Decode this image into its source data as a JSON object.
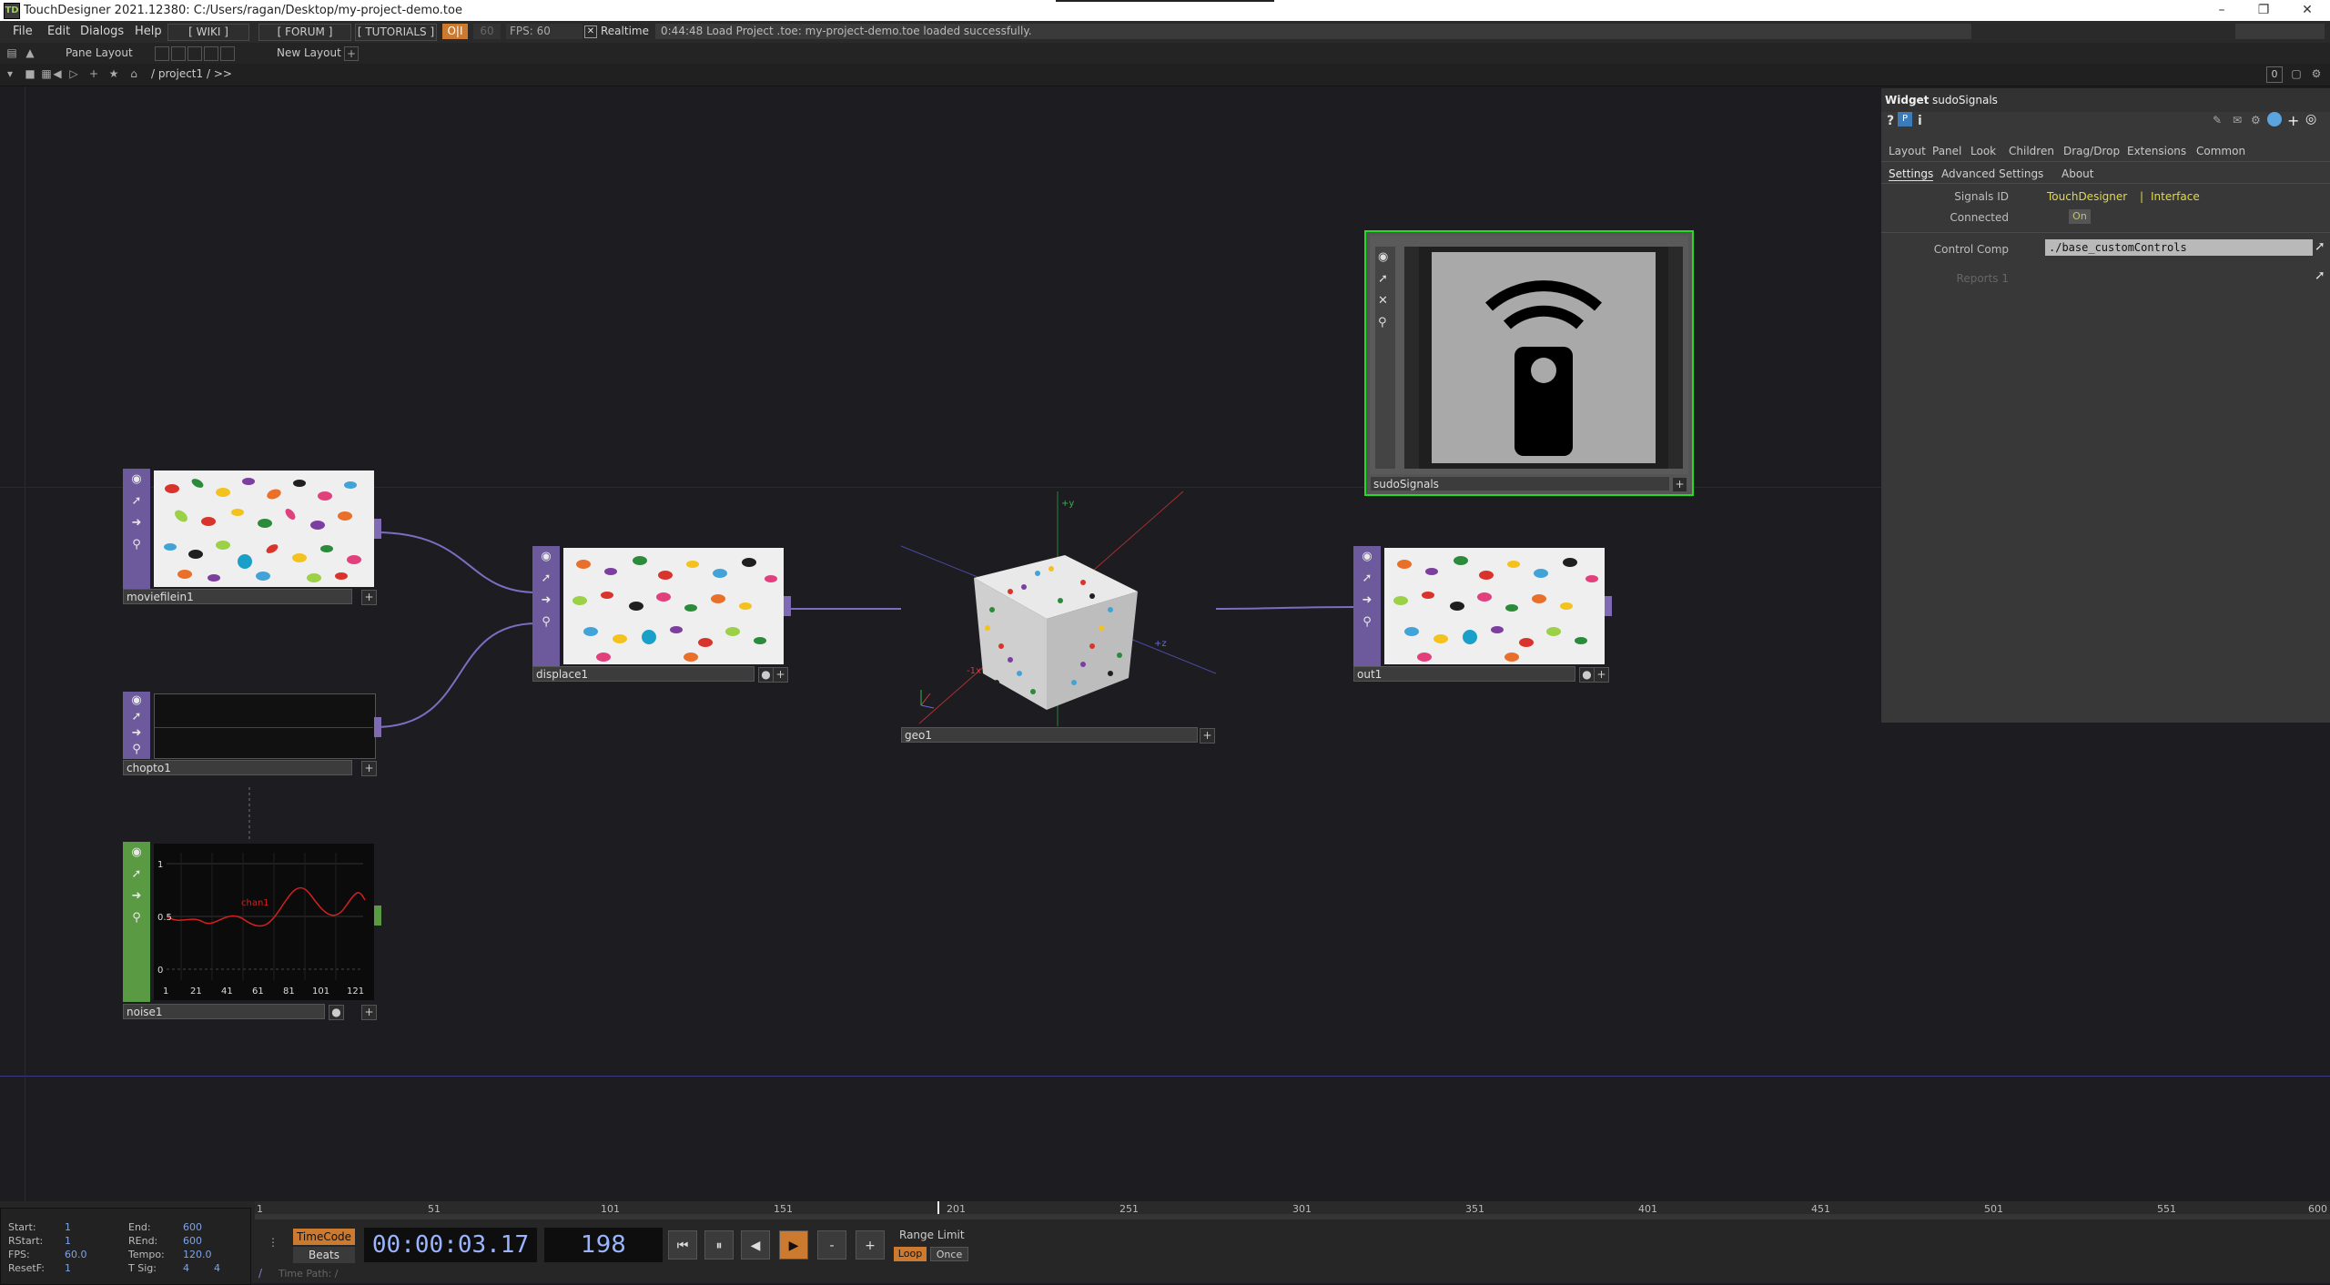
{
  "window": {
    "title": "TouchDesigner 2021.12380: C:/Users/ragan/Desktop/my-project-demo.toe"
  },
  "menu": {
    "items": [
      "File",
      "Edit",
      "Dialogs",
      "Help"
    ],
    "wiki": "[ WIKI ]",
    "forum": "[ FORUM ]",
    "tutorials": "[ TUTORIALS ]",
    "oi": "O|I",
    "fps_cook": "60",
    "fps_label": "FPS: 60",
    "realtime": "Realtime",
    "message": "0:44:48 Load Project .toe: my-project-demo.toe loaded successfully."
  },
  "toolbar": {
    "pane_layout": "Pane Layout",
    "new_layout": "New Layout",
    "plus": "+",
    "path": "/ project1 / >>",
    "counter": "0"
  },
  "nodes": {
    "moviefilein": "moviefilein1",
    "chopto": "chopto1",
    "noise": "noise1",
    "displace": "displace1",
    "geo": "geo1",
    "out": "out1",
    "sudo": "sudoSignals"
  },
  "noise_chart": {
    "channel": "chan1",
    "y_ticks": [
      "1",
      "0.5",
      "0"
    ],
    "x_ticks": [
      "1",
      "21",
      "41",
      "61",
      "81",
      "101",
      "121"
    ]
  },
  "geo_axes": {
    "y": "+y",
    "x": "-1x",
    "z": "+z"
  },
  "params": {
    "type": "Widget",
    "name": "sudoSignals",
    "tabs": [
      "Layout",
      "Panel",
      "Look",
      "Children",
      "Drag/Drop",
      "Extensions",
      "Common"
    ],
    "subtabs": [
      "Settings",
      "Advanced Settings",
      "About"
    ],
    "signals_id_label": "Signals ID",
    "signals_id_value1": "TouchDesigner",
    "signals_id_sep": "|",
    "signals_id_value2": "Interface",
    "connected_label": "Connected",
    "connected_value": "On",
    "control_comp_label": "Control Comp",
    "control_comp_value": "./base_customControls",
    "reports_label": "Reports 1"
  },
  "timeline": {
    "ticks": [
      "1",
      "51",
      "101",
      "151",
      "201",
      "251",
      "301",
      "351",
      "401",
      "451",
      "501",
      "551",
      "600"
    ],
    "start_l": "Start:",
    "start_v": "1",
    "end_l": "End:",
    "end_v": "600",
    "rstart_l": "RStart:",
    "rstart_v": "1",
    "rend_l": "REnd:",
    "rend_v": "600",
    "fps_l": "FPS:",
    "fps_v": "60.0",
    "tempo_l": "Tempo:",
    "tempo_v": "120.0",
    "resetf_l": "ResetF:",
    "resetf_v": "1",
    "tsig_l": "T Sig:",
    "tsig_v1": "4",
    "tsig_v2": "4",
    "timecode_btn": "TimeCode",
    "beats_btn": "Beats",
    "timecode": "00:00:03.17",
    "frame": "198",
    "range_limit": "Range Limit",
    "loop": "Loop",
    "once": "Once",
    "time_path": "Time Path: /",
    "minus": "-",
    "plus": "+"
  },
  "colors": {
    "comp_purple": "#6c5a9c",
    "chop_green": "#5a9a43",
    "selected_green": "#22dd22",
    "accent_orange": "#cc7a2f"
  }
}
